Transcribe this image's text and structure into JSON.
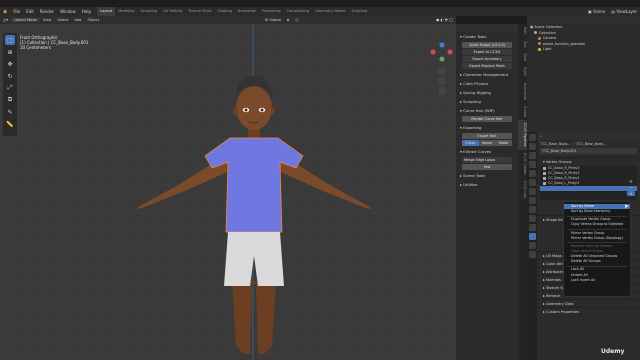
{
  "topbar": {
    "menus": [
      "File",
      "Edit",
      "Render",
      "Window",
      "Help"
    ],
    "workspaces": [
      "Layout",
      "Modeling",
      "Sculpting",
      "UV Editing",
      "Texture Paint",
      "Shading",
      "Animation",
      "Rendering",
      "Compositing",
      "Geometry Nodes",
      "Scripting"
    ],
    "active_workspace": "Layout",
    "scene": "Scene",
    "view_layer": "ViewLayer"
  },
  "viewport_header": {
    "mode": "Object Mode",
    "menus": [
      "View",
      "Select",
      "Add",
      "Object"
    ],
    "orientation": "Global",
    "options": "Options"
  },
  "viewport_info": {
    "line1": "Front Orthographic",
    "line2": "(1) Collection | CC_Base_Body.001",
    "line3": "10 Centimeters"
  },
  "npanel": {
    "create_tools": "Create Tools",
    "quick_export": "Quick Export (v2.0.0)",
    "export_btn": "Export to CC3/4",
    "export_accessory": "Export Accessory",
    "export_replace": "Export Replace Mesh",
    "sections": [
      "Character Management",
      "Cloth Physics",
      "Spring Rigging",
      "Sculpting"
    ],
    "curve_hair": "Curve Hair (WIP)",
    "render_curve_hair": "Render Curve Hair",
    "exporting": "Exporting",
    "export_hair": "Export Hair",
    "tabs3": [
      "Curve",
      "Name",
      "Mode"
    ],
    "extract_curves": "Extract Curves",
    "merge_edge_loops": "Merge Edge Loops",
    "test": "Test",
    "scene_tools": "Scene Tools",
    "utilities": "Utilities"
  },
  "ntabs": [
    "Item",
    "Tool",
    "View",
    "Rigify",
    "Animation",
    "Create",
    "CC/iC Pipeline",
    "CC/iC Create",
    "CC/iC Link"
  ],
  "outliner": {
    "title": "Scene Collection",
    "items": [
      "Collection",
      "Camera",
      "phase_function_gasmtial",
      "Light"
    ]
  },
  "properties": {
    "breadcrumb": "CC_Base_Body...",
    "breadcrumb2": "CC_Base_Body...",
    "object_name": "CC_Base_Body.001",
    "vertex_groups_title": "Vertex Groups",
    "vertex_groups": [
      "CC_Base_R_Pinky3",
      "CC_Base_R_Pinky2",
      "CC_Base_R_Pinky1",
      "CC_Base_L_Pinky3"
    ],
    "shape_keys": "Shape Keys",
    "uv_maps": "UV Maps",
    "color_attributes": "Color Attributes",
    "attributes": "Attributes",
    "normals": "Normals",
    "texture_space": "Texture Space",
    "remesh": "Remesh",
    "geometry_data": "Geometry Data",
    "custom_properties": "Custom Properties"
  },
  "context_menu": {
    "items": [
      {
        "label": "Sort by Name",
        "state": "hl"
      },
      {
        "label": "Sort by Bone Hierarchy",
        "state": ""
      },
      {
        "sep": true
      },
      {
        "label": "Duplicate Vertex Group",
        "state": ""
      },
      {
        "label": "Copy Vertex Group to Selected",
        "state": ""
      },
      {
        "sep": true
      },
      {
        "label": "Mirror Vertex Group",
        "state": ""
      },
      {
        "label": "Mirror Vertex Group (Topology)",
        "state": ""
      },
      {
        "sep": true
      },
      {
        "label": "Remove from All Groups",
        "state": "dim"
      },
      {
        "label": "Clear Active Group",
        "state": "dim"
      },
      {
        "label": "Delete All Unlocked Groups",
        "state": ""
      },
      {
        "label": "Delete All Groups",
        "state": ""
      },
      {
        "sep": true
      },
      {
        "label": "Lock All",
        "state": ""
      },
      {
        "label": "Unlock All",
        "state": ""
      },
      {
        "label": "Lock Invert All",
        "state": ""
      }
    ]
  },
  "watermark": "Udemy",
  "colors": {
    "accent": "#4772b3",
    "shirt": "#6f78e0",
    "skin": "#7a4a2a",
    "shorts": "#d9d9d9",
    "viewport_bg": "#3a3a3a"
  }
}
